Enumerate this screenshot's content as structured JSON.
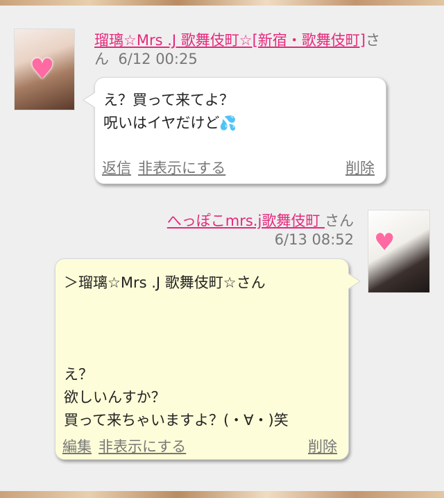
{
  "messages": [
    {
      "author": "瑠璃☆Mrs .J 歌舞伎町☆[新宿・歌舞伎町]",
      "honorific": "さん",
      "time": "6/12 00:25",
      "lines": [
        "え？買って来てよ？",
        "呪いはイヤだけど"
      ],
      "emoji": "💦",
      "actions": {
        "reply": "返信",
        "hide": "非表示にする",
        "delete": "削除"
      }
    },
    {
      "author": "へっぽこmrs.j歌舞伎町 ",
      "honorific": "さん",
      "time": "6/13 08:52",
      "text": "＞瑠璃☆Mrs .J 歌舞伎町☆さん\n\n\n\nえ？\n欲しいんすか？\n買って来ちゃいますよ？(・∀・)笑",
      "actions": {
        "edit": "編集",
        "hide": "非表示にする",
        "delete": "削除"
      }
    }
  ],
  "icons": {
    "avatar_badge": "heart-icon",
    "emoji": "sweat-droplets-icon"
  },
  "colors": {
    "link": "#e5287b",
    "reply_bubble": "#fdfdd9",
    "bubble": "#ffffff",
    "background": "#efefef"
  }
}
